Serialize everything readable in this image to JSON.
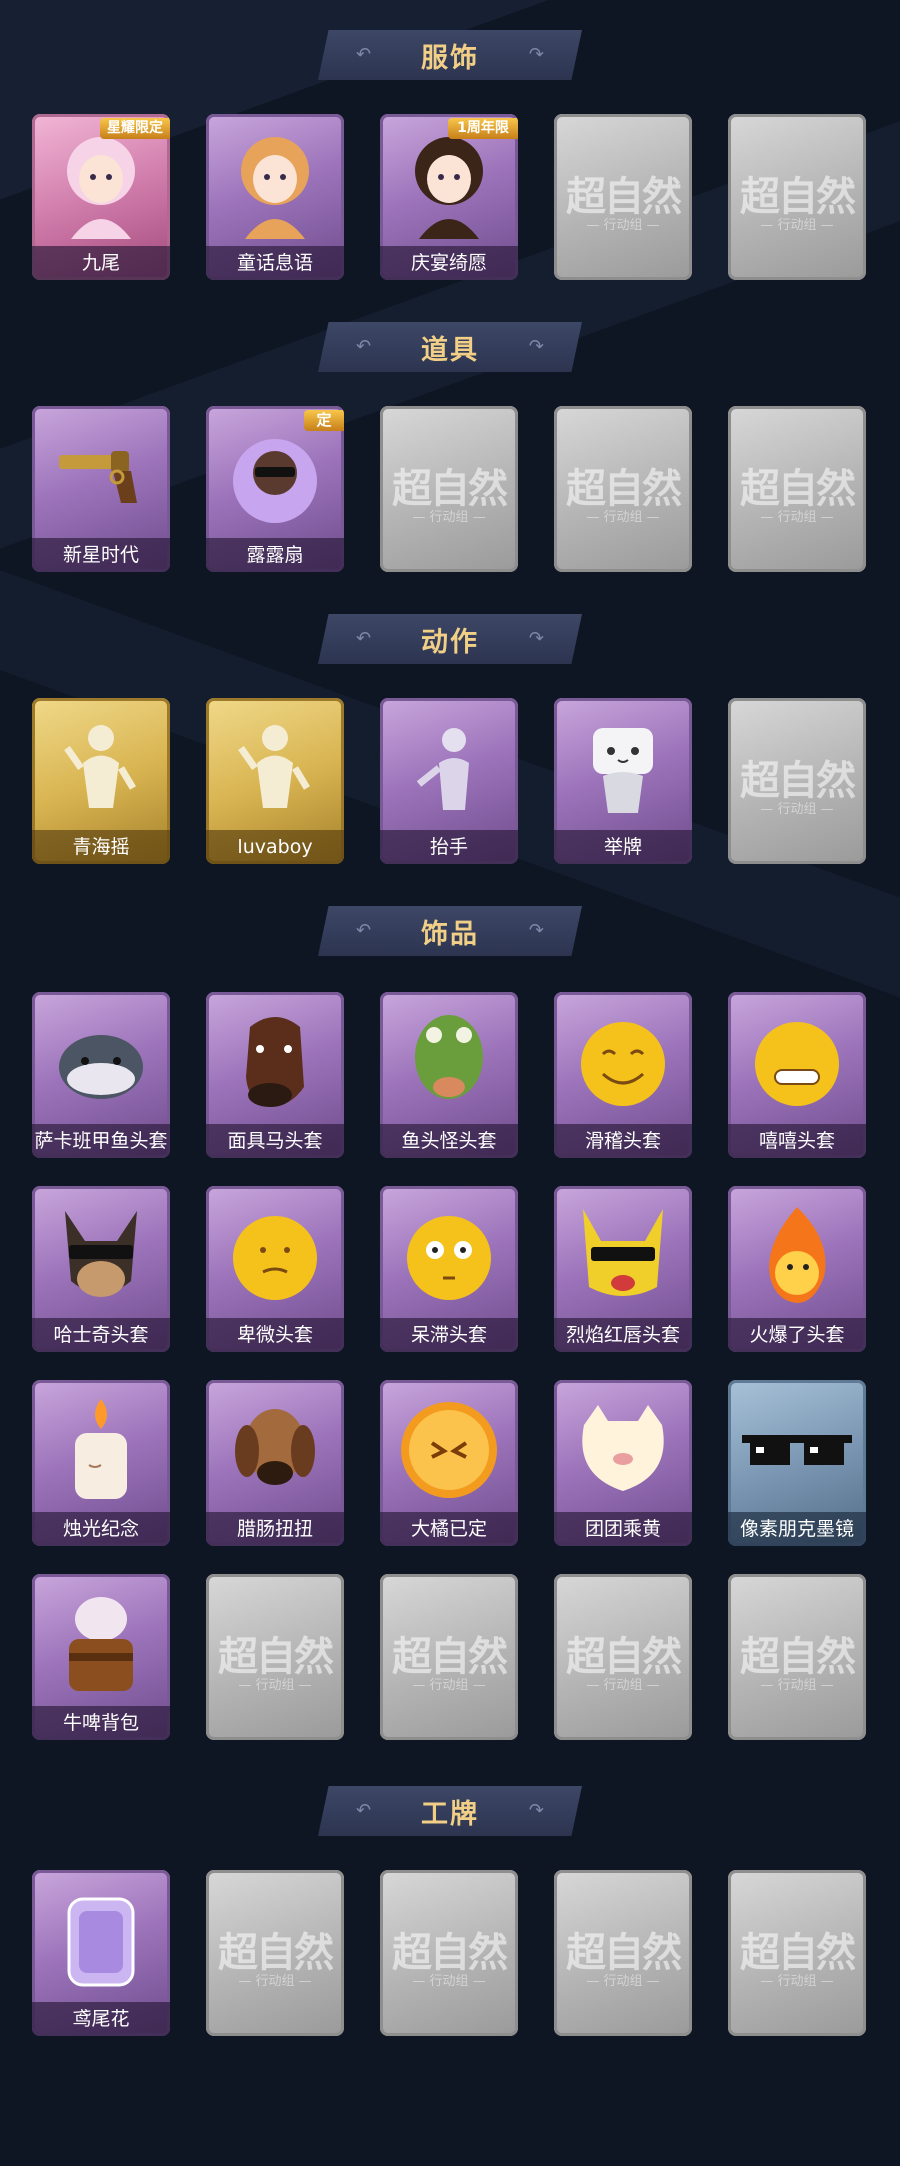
{
  "sections": [
    {
      "title": "服饰",
      "items": [
        {
          "label": "九尾",
          "variant": "pink",
          "icon": "nine-tails-portrait-icon",
          "ribbon": "星耀限定"
        },
        {
          "label": "童话息语",
          "variant": "purple",
          "icon": "fairytale-girl-portrait-icon"
        },
        {
          "label": "庆宴绮愿",
          "variant": "purple",
          "icon": "celebration-cake-portrait-icon",
          "ribbon": "1周年限"
        },
        {
          "label": "",
          "variant": "empty",
          "icon": "locked-placeholder-icon"
        },
        {
          "label": "",
          "variant": "empty",
          "icon": "locked-placeholder-icon"
        }
      ]
    },
    {
      "title": "道具",
      "items": [
        {
          "label": "新星时代",
          "variant": "purple",
          "icon": "revolver-icon"
        },
        {
          "label": "露露扇",
          "variant": "purple",
          "icon": "lulu-fan-icon",
          "ribbon": "定"
        },
        {
          "label": "",
          "variant": "empty",
          "icon": "locked-placeholder-icon"
        },
        {
          "label": "",
          "variant": "empty",
          "icon": "locked-placeholder-icon"
        },
        {
          "label": "",
          "variant": "empty",
          "icon": "locked-placeholder-icon"
        }
      ]
    },
    {
      "title": "动作",
      "items": [
        {
          "label": "青海摇",
          "variant": "gold",
          "icon": "dance-figure-icon"
        },
        {
          "label": "luvaboy",
          "variant": "gold",
          "icon": "dance-figure-icon"
        },
        {
          "label": "抬手",
          "variant": "purple",
          "icon": "raise-hand-icon"
        },
        {
          "label": "举牌",
          "variant": "purple",
          "icon": "hold-sign-icon"
        },
        {
          "label": "",
          "variant": "empty",
          "icon": "locked-placeholder-icon"
        }
      ]
    },
    {
      "title": "饰品",
      "items": [
        {
          "label": "萨卡班甲鱼头套",
          "variant": "purple",
          "icon": "fish-head-icon"
        },
        {
          "label": "面具马头套",
          "variant": "purple",
          "icon": "horse-head-icon"
        },
        {
          "label": "鱼头怪头套",
          "variant": "purple",
          "icon": "fish-monster-head-icon"
        },
        {
          "label": "滑稽头套",
          "variant": "purple",
          "icon": "funny-face-icon"
        },
        {
          "label": "嘻嘻头套",
          "variant": "purple",
          "icon": "grin-face-icon"
        },
        {
          "label": "哈士奇头套",
          "variant": "purple",
          "icon": "husky-head-icon"
        },
        {
          "label": "卑微头套",
          "variant": "purple",
          "icon": "humble-face-icon"
        },
        {
          "label": "呆滞头套",
          "variant": "purple",
          "icon": "dazed-face-icon"
        },
        {
          "label": "烈焰红唇头套",
          "variant": "purple",
          "icon": "pikachu-head-icon"
        },
        {
          "label": "火爆了头套",
          "variant": "purple",
          "icon": "fire-head-icon"
        },
        {
          "label": "烛光纪念",
          "variant": "purple",
          "icon": "candle-icon"
        },
        {
          "label": "腊肠扭扭",
          "variant": "purple",
          "icon": "dachshund-icon"
        },
        {
          "label": "大橘已定",
          "variant": "purple",
          "icon": "orange-slice-icon"
        },
        {
          "label": "团团乘黄",
          "variant": "purple",
          "icon": "cat-plush-icon"
        },
        {
          "label": "像素朋克墨镜",
          "variant": "blue",
          "icon": "pixel-sunglasses-icon"
        },
        {
          "label": "牛啤背包",
          "variant": "purple",
          "icon": "cow-beer-backpack-icon"
        },
        {
          "label": "",
          "variant": "empty",
          "icon": "locked-placeholder-icon"
        },
        {
          "label": "",
          "variant": "empty",
          "icon": "locked-placeholder-icon"
        },
        {
          "label": "",
          "variant": "empty",
          "icon": "locked-placeholder-icon"
        },
        {
          "label": "",
          "variant": "empty",
          "icon": "locked-placeholder-icon"
        }
      ]
    },
    {
      "title": "工牌",
      "items": [
        {
          "label": "鸢尾花",
          "variant": "purple",
          "icon": "iris-badge-icon"
        },
        {
          "label": "",
          "variant": "empty",
          "icon": "locked-placeholder-icon"
        },
        {
          "label": "",
          "variant": "empty",
          "icon": "locked-placeholder-icon"
        },
        {
          "label": "",
          "variant": "empty",
          "icon": "locked-placeholder-icon"
        },
        {
          "label": "",
          "variant": "empty",
          "icon": "locked-placeholder-icon"
        }
      ]
    }
  ],
  "placeholder": {
    "main": "超自然",
    "sub": "— 行动组 —"
  },
  "colors": {
    "background": "#0e1624",
    "title": "#f1cf86",
    "banner": "#3d4766"
  }
}
